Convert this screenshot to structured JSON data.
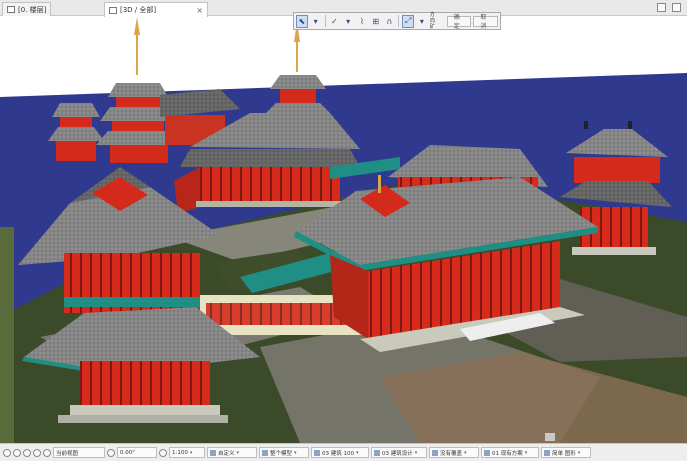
{
  "tabs": [
    {
      "label": "[0. 楼层]",
      "active": false
    },
    {
      "label": "[3D / 全部]",
      "active": true
    }
  ],
  "toolbar": {
    "small_label_top": "方向",
    "small_label_bottom": "矿",
    "confirm_label": "确定",
    "cancel_label": "取消"
  },
  "statusbar": {
    "zoom_mode": "当前视图",
    "angle": "0.00°",
    "scale": "1:100",
    "custom": "自定义",
    "model": "整个模型",
    "layer_combo": "03 建筑 100",
    "design": "03 建筑设计",
    "override": "没有覆盖",
    "renovation": "01 现有方案",
    "mvo": "简单 图形"
  },
  "colors": {
    "sky": "#ffffff",
    "ground_blue": "#2e3a8e",
    "lawn": "#3a4a27",
    "paving": "#7b7b6e",
    "roof": "#8c8c8c",
    "red": "#d42a1c",
    "teal": "#1f8f86",
    "gold": "#d9a64a"
  }
}
